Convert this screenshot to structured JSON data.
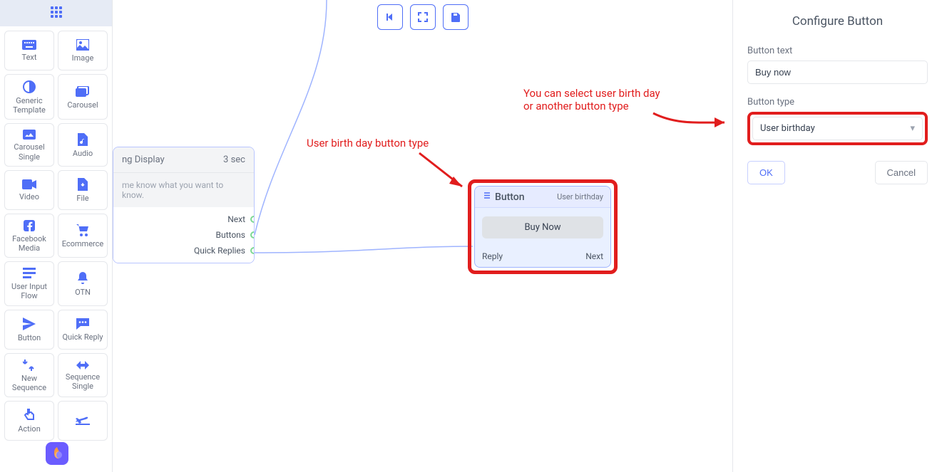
{
  "sidebar": {
    "items": [
      {
        "label": "Text",
        "icon": "keyboard"
      },
      {
        "label": "Image",
        "icon": "image"
      },
      {
        "label": "Generic Template",
        "icon": "contrast"
      },
      {
        "label": "Carousel",
        "icon": "images"
      },
      {
        "label": "Carousel Single",
        "icon": "image-single"
      },
      {
        "label": "Audio",
        "icon": "file-audio"
      },
      {
        "label": "Video",
        "icon": "video"
      },
      {
        "label": "File",
        "icon": "file"
      },
      {
        "label": "Facebook Media",
        "icon": "facebook"
      },
      {
        "label": "Ecommerce",
        "icon": "cart"
      },
      {
        "label": "User Input Flow",
        "icon": "input-flow"
      },
      {
        "label": "OTN",
        "icon": "bell"
      },
      {
        "label": "Button",
        "icon": "send"
      },
      {
        "label": "Quick Reply",
        "icon": "chat"
      },
      {
        "label": "New Sequence",
        "icon": "sequence"
      },
      {
        "label": "Sequence Single",
        "icon": "sequence-single"
      },
      {
        "label": "Action",
        "icon": "pointer"
      },
      {
        "label": "",
        "icon": "plane"
      }
    ]
  },
  "canvas": {
    "typing_node": {
      "title_suffix": "ng Display",
      "duration": "3 sec",
      "hint": "me know what you want to know.",
      "ports": [
        "Next",
        "Buttons",
        "Quick Replies"
      ]
    },
    "button_node": {
      "title": "Button",
      "tag": "User birthday",
      "button_label": "Buy Now",
      "left_port": "Reply",
      "right_port": "Next"
    },
    "annotations": {
      "a1": "User birth day button type",
      "a2_l1": "You can select user birth day",
      "a2_l2": "or another button type"
    }
  },
  "panel": {
    "title": "Configure Button",
    "text_label": "Button text",
    "text_value": "Buy now",
    "type_label": "Button type",
    "type_value": "User birthday",
    "ok": "OK",
    "cancel": "Cancel"
  }
}
